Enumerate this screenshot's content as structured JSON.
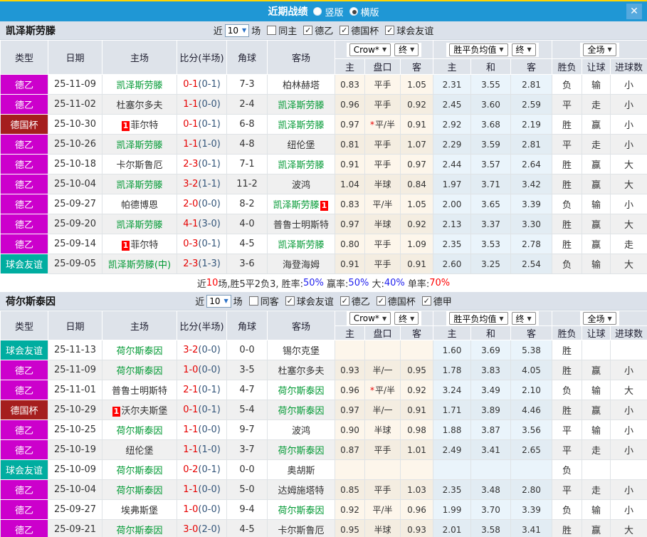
{
  "titlebar": {
    "title": "近期战绩",
    "options": [
      {
        "label": "竖版",
        "checked": false
      },
      {
        "label": "横版",
        "checked": true
      }
    ],
    "close_label": "✕"
  },
  "filter_labels": {
    "near": "近",
    "games": "场"
  },
  "columns": {
    "widths": [
      67,
      76,
      105,
      70,
      57,
      95,
      42,
      50,
      46,
      53,
      56,
      58,
      42,
      40,
      52
    ],
    "main": [
      "类型",
      "日期",
      "主场",
      "比分(半场)",
      "角球",
      "客场"
    ],
    "sub": [
      "主",
      "盘口",
      "客",
      "主",
      "和",
      "客",
      "胜负",
      "让球",
      "进球数"
    ],
    "dropdowns": {
      "odds": "Crow*",
      "final": "终",
      "avg": "胜平负均值",
      "full": "全场"
    }
  },
  "colors": {
    "leagues": {
      "德乙": "#cc00cc",
      "德国杯": "#a51e1e",
      "球会友谊": "#00ada0"
    },
    "topbar": "#1f97d5",
    "self_team": "#009933"
  },
  "sections": [
    {
      "team": "凯泽斯劳滕",
      "filter": {
        "count": "10",
        "unchecked": "同主",
        "checked": [
          "德乙",
          "德国杯",
          "球会友谊"
        ]
      },
      "rows": [
        {
          "league": "德乙",
          "date": "25-11-09",
          "home": {
            "t": "凯泽斯劳滕",
            "self": true
          },
          "score": "0-1",
          "half": "(0-1)",
          "corners": "7-3",
          "away": {
            "t": "柏林赫塔"
          },
          "odds": [
            "0.83",
            "平手",
            "1.05"
          ],
          "star": false,
          "avg": [
            "2.31",
            "3.55",
            "2.81"
          ],
          "res": [
            "负|g",
            "输|g",
            "小|g"
          ]
        },
        {
          "league": "德乙",
          "date": "25-11-02",
          "home": {
            "t": "杜塞尔多夫"
          },
          "score": "1-1",
          "half": "(0-0)",
          "corners": "2-4",
          "away": {
            "t": "凯泽斯劳滕",
            "self": true
          },
          "odds": [
            "0.96",
            "平手",
            "0.92"
          ],
          "star": false,
          "avg": [
            "2.45",
            "3.60",
            "2.59"
          ],
          "res": [
            "平|b",
            "走|b",
            "小|g"
          ]
        },
        {
          "league": "德国杯",
          "date": "25-10-30",
          "home": {
            "t": "菲尔特",
            "pre": "1"
          },
          "score": "0-1",
          "half": "(0-1)",
          "corners": "6-8",
          "away": {
            "t": "凯泽斯劳滕",
            "self": true
          },
          "odds": [
            "0.97",
            "平/半",
            "0.91"
          ],
          "star": true,
          "avg": [
            "2.92",
            "3.68",
            "2.19"
          ],
          "res": [
            "胜|r",
            "赢|r",
            "小|g"
          ]
        },
        {
          "league": "德乙",
          "date": "25-10-26",
          "home": {
            "t": "凯泽斯劳滕",
            "self": true
          },
          "score": "1-1",
          "half": "(1-0)",
          "corners": "4-8",
          "away": {
            "t": "纽伦堡"
          },
          "odds": [
            "0.81",
            "平手",
            "1.07"
          ],
          "star": false,
          "avg": [
            "2.29",
            "3.59",
            "2.81"
          ],
          "res": [
            "平|b",
            "走|b",
            "小|g"
          ]
        },
        {
          "league": "德乙",
          "date": "25-10-18",
          "home": {
            "t": "卡尔斯鲁厄"
          },
          "score": "2-3",
          "half": "(0-1)",
          "corners": "7-1",
          "away": {
            "t": "凯泽斯劳滕",
            "self": true
          },
          "odds": [
            "0.91",
            "平手",
            "0.97"
          ],
          "star": false,
          "avg": [
            "2.44",
            "3.57",
            "2.64"
          ],
          "res": [
            "胜|r",
            "赢|r",
            "大|r"
          ]
        },
        {
          "league": "德乙",
          "date": "25-10-04",
          "home": {
            "t": "凯泽斯劳滕",
            "self": true
          },
          "score": "3-2",
          "half": "(1-1)",
          "corners": "11-2",
          "away": {
            "t": "波鸿"
          },
          "odds": [
            "1.04",
            "半球",
            "0.84"
          ],
          "star": false,
          "avg": [
            "1.97",
            "3.71",
            "3.42"
          ],
          "res": [
            "胜|r",
            "赢|r",
            "大|r"
          ]
        },
        {
          "league": "德乙",
          "date": "25-09-27",
          "home": {
            "t": "帕德博恩"
          },
          "score": "2-0",
          "half": "(0-0)",
          "corners": "8-2",
          "away": {
            "t": "凯泽斯劳滕",
            "self": true,
            "post": "1"
          },
          "odds": [
            "0.83",
            "平/半",
            "1.05"
          ],
          "star": false,
          "avg": [
            "2.00",
            "3.65",
            "3.39"
          ],
          "res": [
            "负|g",
            "输|g",
            "小|g"
          ]
        },
        {
          "league": "德乙",
          "date": "25-09-20",
          "home": {
            "t": "凯泽斯劳滕",
            "self": true
          },
          "score": "4-1",
          "half": "(3-0)",
          "corners": "4-0",
          "away": {
            "t": "普鲁士明斯特"
          },
          "odds": [
            "0.97",
            "半球",
            "0.92"
          ],
          "star": false,
          "avg": [
            "2.13",
            "3.37",
            "3.30"
          ],
          "res": [
            "胜|r",
            "赢|r",
            "大|r"
          ]
        },
        {
          "league": "德乙",
          "date": "25-09-14",
          "home": {
            "t": "菲尔特",
            "pre": "1"
          },
          "score": "0-3",
          "half": "(0-1)",
          "corners": "4-5",
          "away": {
            "t": "凯泽斯劳滕",
            "self": true
          },
          "odds": [
            "0.80",
            "平手",
            "1.09"
          ],
          "star": false,
          "avg": [
            "2.35",
            "3.53",
            "2.78"
          ],
          "res": [
            "胜|r",
            "赢|r",
            "走|b"
          ]
        },
        {
          "league": "球会友谊",
          "date": "25-09-05",
          "home": {
            "t": "凯泽斯劳滕(中)",
            "self": true
          },
          "score": "2-3",
          "half": "(1-3)",
          "corners": "3-6",
          "away": {
            "t": "海登海姆"
          },
          "odds": [
            "0.91",
            "平手",
            "0.91"
          ],
          "star": false,
          "avg": [
            "2.60",
            "3.25",
            "2.54"
          ],
          "res": [
            "负|g",
            "输|g",
            "大|r"
          ]
        }
      ],
      "summary": [
        {
          "t": "近",
          "c": "k"
        },
        {
          "t": "10",
          "c": "r"
        },
        {
          "t": "场,胜5平2负3, ",
          "c": "k"
        },
        {
          "t": "胜率:",
          "c": "k"
        },
        {
          "t": "50%",
          "c": "b"
        },
        {
          "t": " 赢率:",
          "c": "k"
        },
        {
          "t": "50%",
          "c": "b"
        },
        {
          "t": " 大:",
          "c": "k"
        },
        {
          "t": "40%",
          "c": "b"
        },
        {
          "t": " 单率:",
          "c": "k"
        },
        {
          "t": "70%",
          "c": "r"
        }
      ]
    },
    {
      "team": "荷尔斯泰因",
      "filter": {
        "count": "10",
        "unchecked": "同客",
        "checked": [
          "球会友谊",
          "德乙",
          "德国杯",
          "德甲"
        ]
      },
      "rows": [
        {
          "league": "球会友谊",
          "date": "25-11-13",
          "home": {
            "t": "荷尔斯泰因",
            "self": true
          },
          "score": "3-2",
          "half": "(0-0)",
          "corners": "0-0",
          "away": {
            "t": "锡尔克堡"
          },
          "odds": [
            "",
            "",
            ""
          ],
          "star": false,
          "avg": [
            "1.60",
            "3.69",
            "5.38"
          ],
          "res": [
            "胜|r",
            "",
            ""
          ]
        },
        {
          "league": "德乙",
          "date": "25-11-09",
          "home": {
            "t": "荷尔斯泰因",
            "self": true
          },
          "score": "1-0",
          "half": "(0-0)",
          "corners": "3-5",
          "away": {
            "t": "杜塞尔多夫"
          },
          "odds": [
            "0.93",
            "半/一",
            "0.95"
          ],
          "star": false,
          "avg": [
            "1.78",
            "3.83",
            "4.05"
          ],
          "res": [
            "胜|r",
            "赢|r",
            "小|g"
          ]
        },
        {
          "league": "德乙",
          "date": "25-11-01",
          "home": {
            "t": "普鲁士明斯特"
          },
          "score": "2-1",
          "half": "(0-1)",
          "corners": "4-7",
          "away": {
            "t": "荷尔斯泰因",
            "self": true
          },
          "odds": [
            "0.96",
            "平/半",
            "0.92"
          ],
          "star": true,
          "avg": [
            "3.24",
            "3.49",
            "2.10"
          ],
          "res": [
            "负|g",
            "输|g",
            "大|r"
          ]
        },
        {
          "league": "德国杯",
          "date": "25-10-29",
          "home": {
            "t": "沃尔夫斯堡",
            "pre": "1"
          },
          "score": "0-1",
          "half": "(0-1)",
          "corners": "5-4",
          "away": {
            "t": "荷尔斯泰因",
            "self": true
          },
          "odds": [
            "0.97",
            "半/一",
            "0.91"
          ],
          "star": false,
          "avg": [
            "1.71",
            "3.89",
            "4.46"
          ],
          "res": [
            "胜|r",
            "赢|r",
            "小|g"
          ]
        },
        {
          "league": "德乙",
          "date": "25-10-25",
          "home": {
            "t": "荷尔斯泰因",
            "self": true
          },
          "score": "1-1",
          "half": "(0-0)",
          "corners": "9-7",
          "away": {
            "t": "波鸿"
          },
          "odds": [
            "0.90",
            "半球",
            "0.98"
          ],
          "star": false,
          "avg": [
            "1.88",
            "3.87",
            "3.56"
          ],
          "res": [
            "平|b",
            "输|g",
            "小|g"
          ]
        },
        {
          "league": "德乙",
          "date": "25-10-19",
          "home": {
            "t": "纽伦堡"
          },
          "score": "1-1",
          "half": "(1-0)",
          "corners": "3-7",
          "away": {
            "t": "荷尔斯泰因",
            "self": true
          },
          "odds": [
            "0.87",
            "平手",
            "1.01"
          ],
          "star": false,
          "avg": [
            "2.49",
            "3.41",
            "2.65"
          ],
          "res": [
            "平|b",
            "走|b",
            "小|g"
          ]
        },
        {
          "league": "球会友谊",
          "date": "25-10-09",
          "home": {
            "t": "荷尔斯泰因",
            "self": true
          },
          "score": "0-2",
          "half": "(0-1)",
          "corners": "0-0",
          "away": {
            "t": "奥胡斯"
          },
          "odds": [
            "",
            "",
            ""
          ],
          "star": false,
          "avg": [
            "",
            "",
            ""
          ],
          "res": [
            "负|g",
            "",
            ""
          ]
        },
        {
          "league": "德乙",
          "date": "25-10-04",
          "home": {
            "t": "荷尔斯泰因",
            "self": true
          },
          "score": "1-1",
          "half": "(0-0)",
          "corners": "5-0",
          "away": {
            "t": "达姆施塔特"
          },
          "odds": [
            "0.85",
            "平手",
            "1.03"
          ],
          "star": false,
          "avg": [
            "2.35",
            "3.48",
            "2.80"
          ],
          "res": [
            "平|b",
            "走|b",
            "小|g"
          ]
        },
        {
          "league": "德乙",
          "date": "25-09-27",
          "home": {
            "t": "埃弗斯堡"
          },
          "score": "1-0",
          "half": "(0-0)",
          "corners": "9-4",
          "away": {
            "t": "荷尔斯泰因",
            "self": true
          },
          "odds": [
            "0.92",
            "平/半",
            "0.96"
          ],
          "star": false,
          "avg": [
            "1.99",
            "3.70",
            "3.39"
          ],
          "res": [
            "负|g",
            "输|g",
            "小|g"
          ]
        },
        {
          "league": "德乙",
          "date": "25-09-21",
          "home": {
            "t": "荷尔斯泰因",
            "self": true
          },
          "score": "3-0",
          "half": "(2-0)",
          "corners": "4-5",
          "away": {
            "t": "卡尔斯鲁厄"
          },
          "odds": [
            "0.95",
            "半球",
            "0.93"
          ],
          "star": false,
          "avg": [
            "2.01",
            "3.58",
            "3.41"
          ],
          "res": [
            "胜|r",
            "赢|r",
            "大|r"
          ]
        }
      ],
      "summary": null
    }
  ]
}
